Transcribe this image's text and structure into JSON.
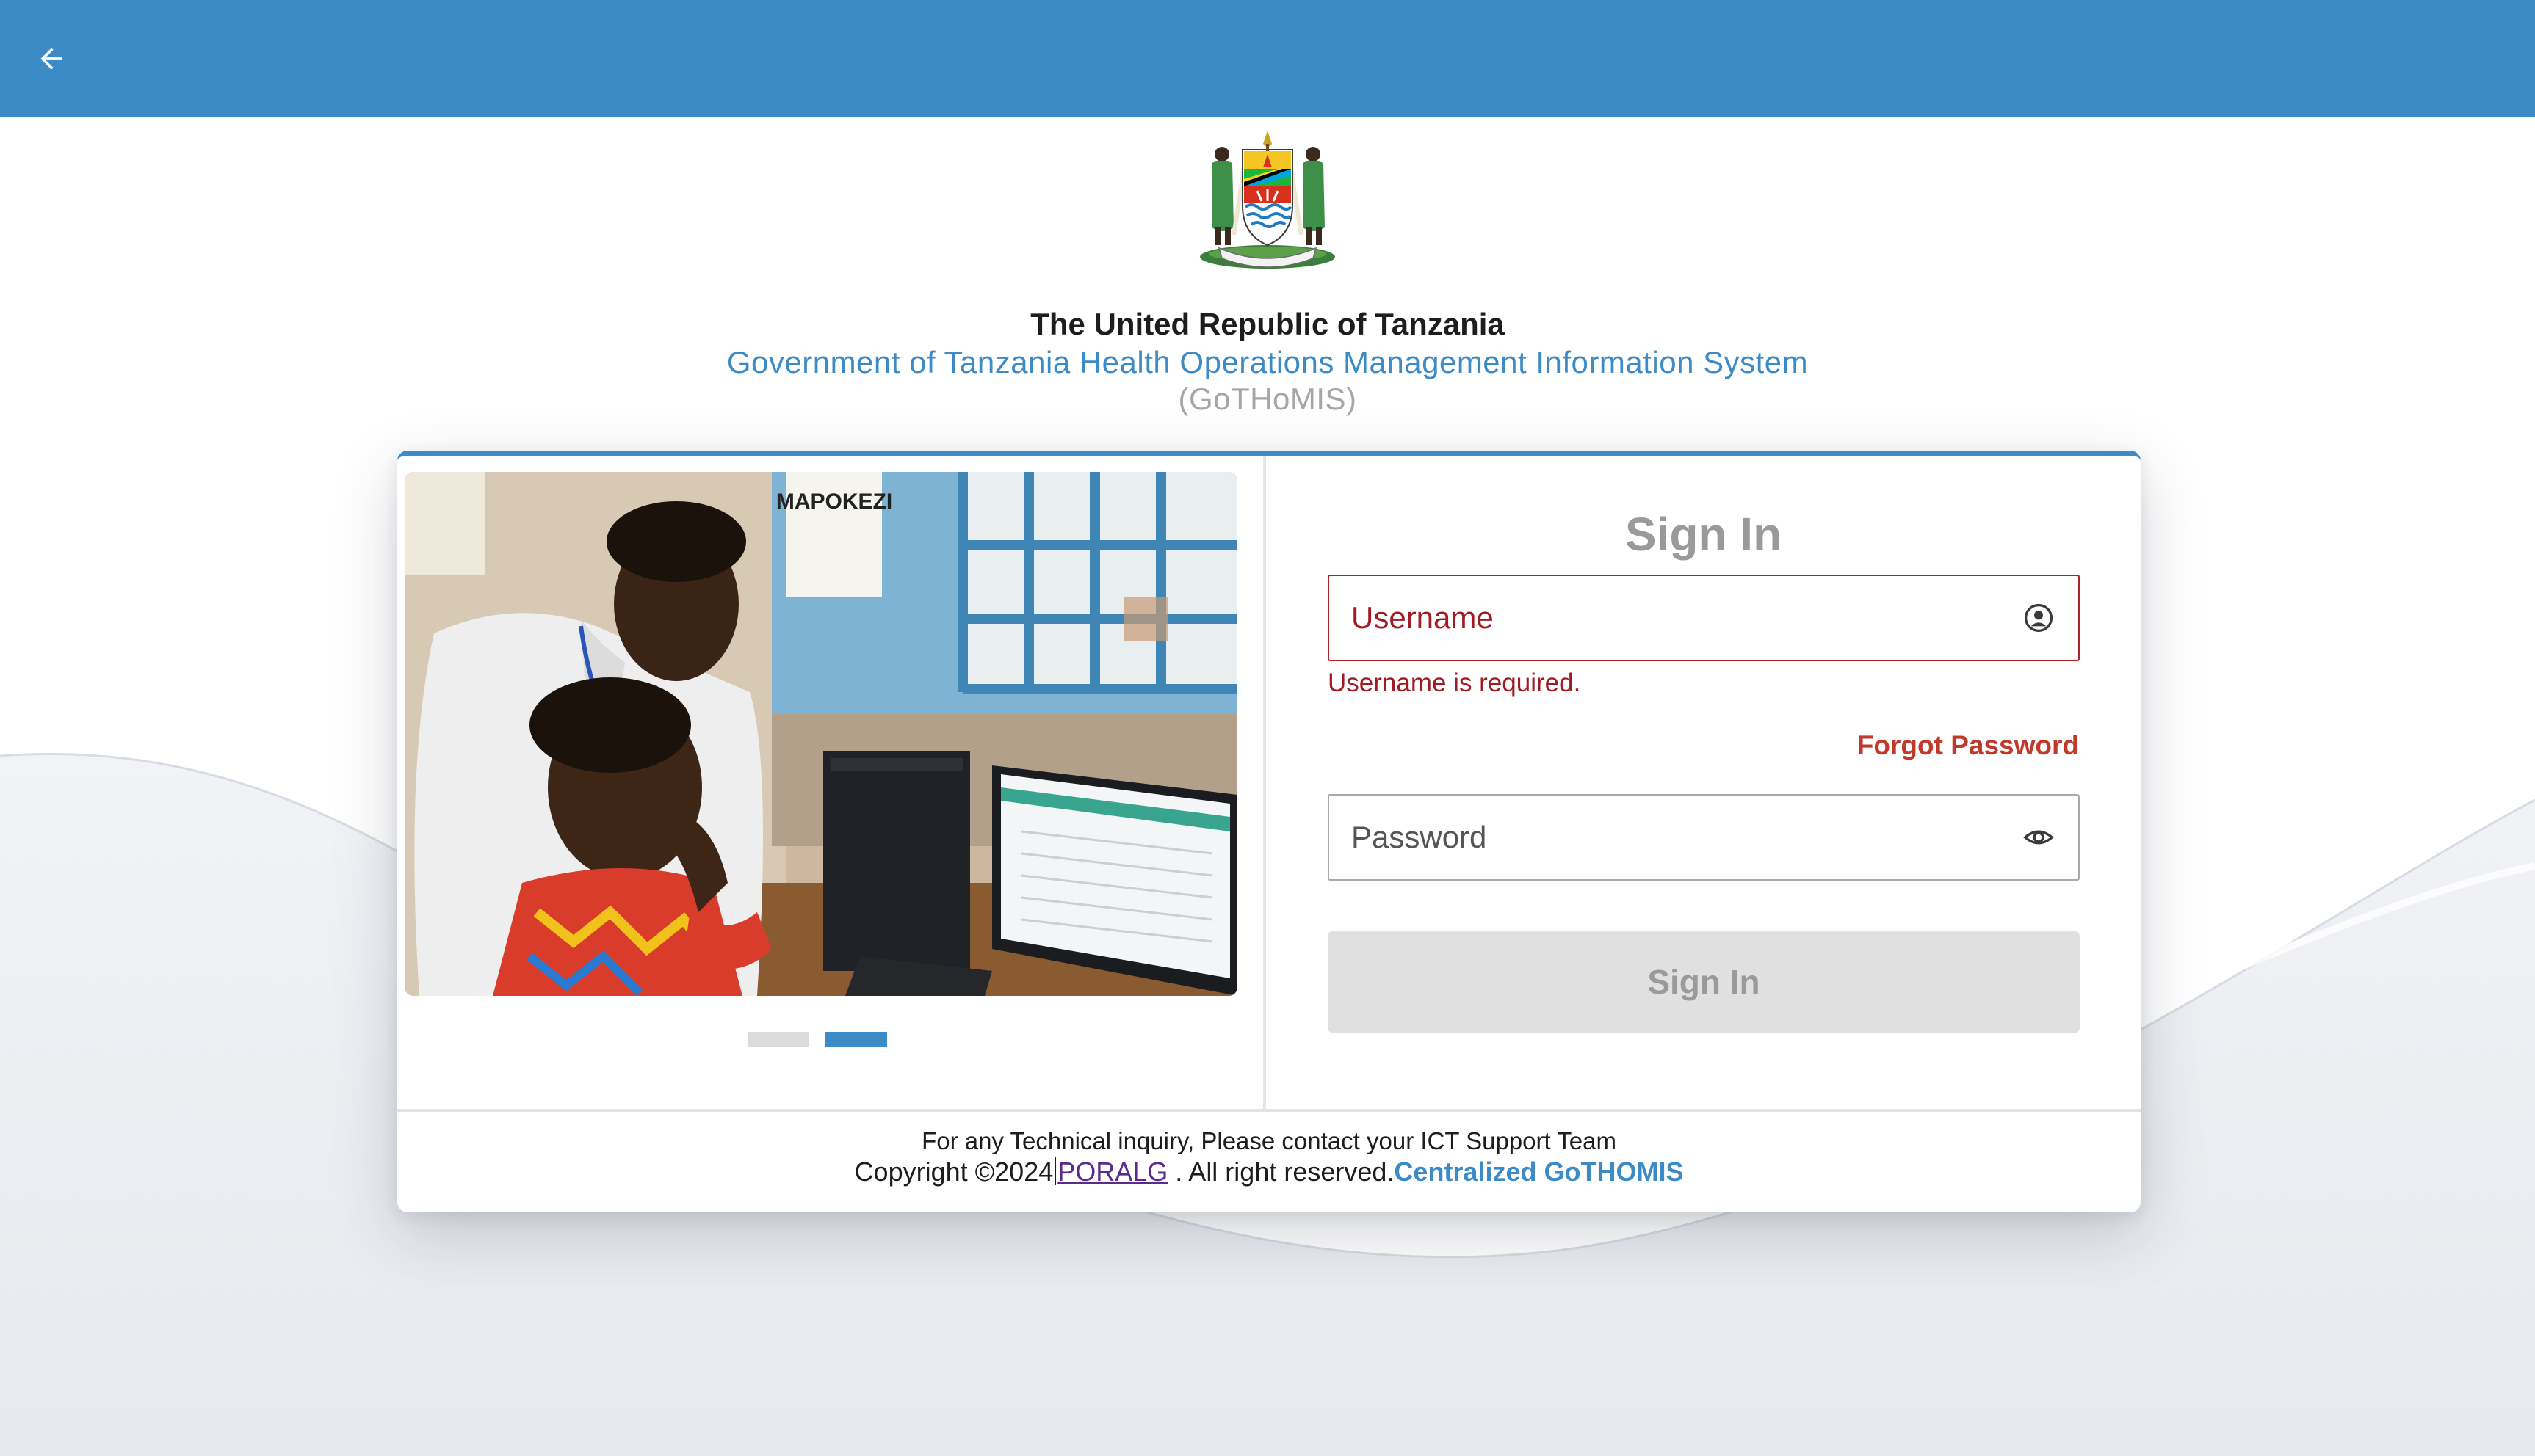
{
  "header": {
    "back_icon": "arrow-left-icon",
    "bar_color": "#3d8bc6"
  },
  "branding": {
    "crest_icon": "tanzania-coat-of-arms",
    "country": "The United Republic of Tanzania",
    "system_name": "Government of Tanzania Health Operations Management Information System",
    "system_abbr": "(GoTHoMIS)"
  },
  "carousel": {
    "slide_count": 2,
    "active_index": 1
  },
  "signin": {
    "title": "Sign In",
    "username_placeholder": "Username",
    "username_icon": "account-circle-icon",
    "username_error": "Username is required.",
    "forgot_label": "Forgot Password",
    "password_placeholder": "Password",
    "password_icon": "eye-icon",
    "submit_label": "Sign In"
  },
  "footer": {
    "inquiry": "For any Technical inquiry, Please contact your ICT Support Team",
    "copyright_prefix": "Copyright ©2024",
    "org_link": "PORALG",
    "rights": " . All right reserved.",
    "product": "Centralized GoTHOMIS"
  },
  "colors": {
    "accent": "#3d8bc6",
    "error": "#a11b24",
    "forgot": "#c0392b",
    "disabled_button": "#e0e0e0"
  }
}
